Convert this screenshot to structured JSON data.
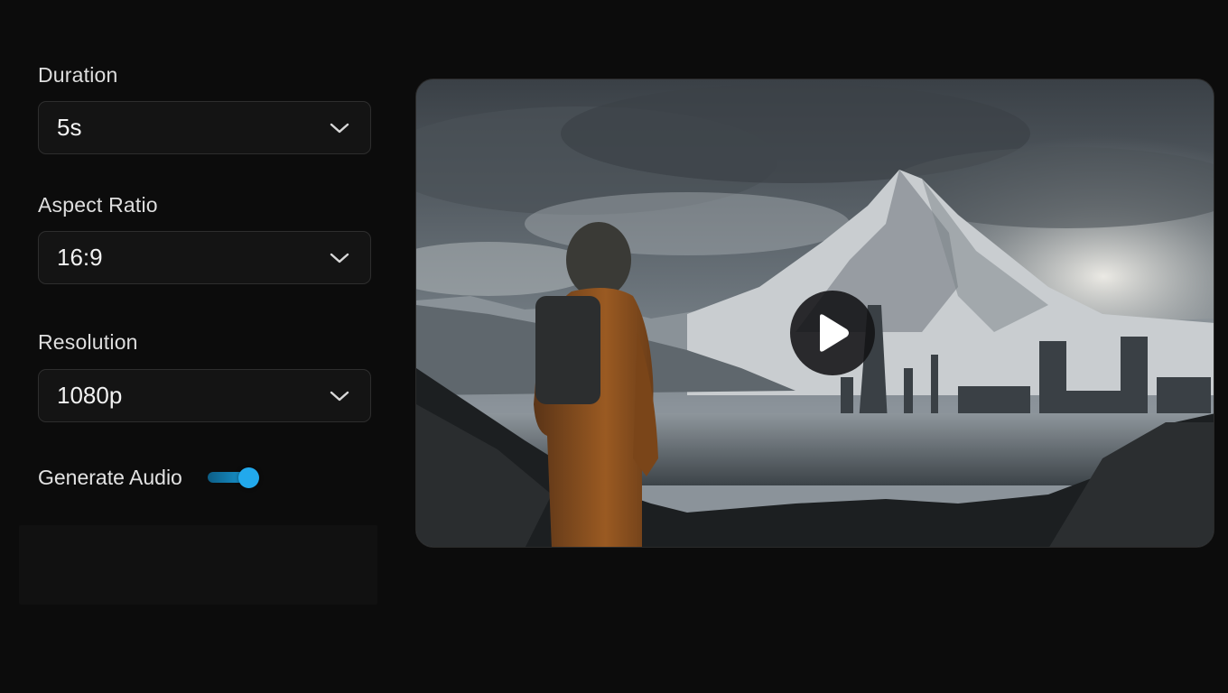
{
  "settings": {
    "duration": {
      "label": "Duration",
      "value": "5s"
    },
    "aspect_ratio": {
      "label": "Aspect Ratio",
      "value": "16:9"
    },
    "resolution": {
      "label": "Resolution",
      "value": "1080p"
    },
    "generate_audio": {
      "label": "Generate Audio",
      "enabled": true
    }
  },
  "colors": {
    "background": "#0c0c0c",
    "select_bg": "#141414",
    "select_border": "#2e2e2e",
    "accent": "#22a9ec"
  },
  "icons": {
    "dropdown": "chevron-down-icon",
    "play": "play-icon"
  }
}
